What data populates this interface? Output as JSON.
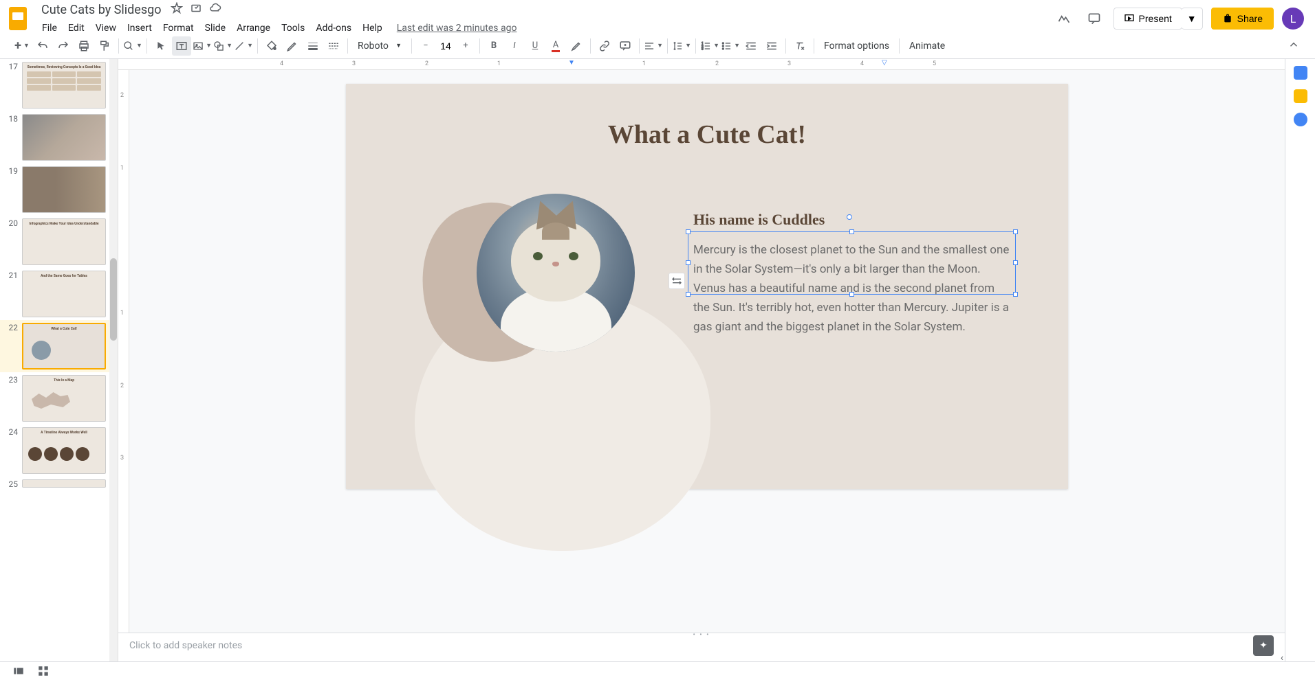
{
  "doc": {
    "title": "Cute Cats by Slidesgo",
    "last_edit": "Last edit was 2 minutes ago"
  },
  "menu": {
    "file": "File",
    "edit": "Edit",
    "view": "View",
    "insert": "Insert",
    "format": "Format",
    "slide": "Slide",
    "arrange": "Arrange",
    "tools": "Tools",
    "addons": "Add-ons",
    "help": "Help"
  },
  "header_actions": {
    "present": "Present",
    "share": "Share",
    "avatar_initial": "L"
  },
  "toolbar": {
    "font": "Roboto",
    "font_size": "14",
    "format_options": "Format options",
    "animate": "Animate"
  },
  "slide": {
    "title": "What a Cute Cat!",
    "subtitle": "His name is Cuddles",
    "body": "Mercury is the closest planet to the Sun and the smallest one in the Solar System—it's only a bit larger than the Moon. Venus has a beautiful name and is the second planet from the Sun. It's terribly hot, even hotter than Mercury. Jupiter is a gas giant and the biggest planet in the Solar System."
  },
  "notes": {
    "placeholder": "Click to add speaker notes"
  },
  "thumbs": {
    "n17": "17",
    "n18": "18",
    "n19": "19",
    "n20": "20",
    "n21": "21",
    "n22": "22",
    "n23": "23",
    "n24": "24",
    "n25": "25",
    "t17": "Sometimes, Reviewing Concepts Is a Good Idea",
    "t20": "Infographics Make Your Idea Understandable",
    "t21": "And the Same Goes for Tables",
    "t22": "What a Cute Cat!",
    "t23": "This Is a Map",
    "t24": "A Timeline Always Works Well"
  },
  "ruler_h": {
    "m1": "1",
    "m2": "2",
    "m3": "3",
    "m4": "4",
    "p1": "1",
    "p2": "2",
    "p3": "3",
    "p4": "4",
    "p5": "5"
  },
  "ruler_v": {
    "m1": "1",
    "m2": "2",
    "m3": "3",
    "p1": "1",
    "p2": "2"
  }
}
